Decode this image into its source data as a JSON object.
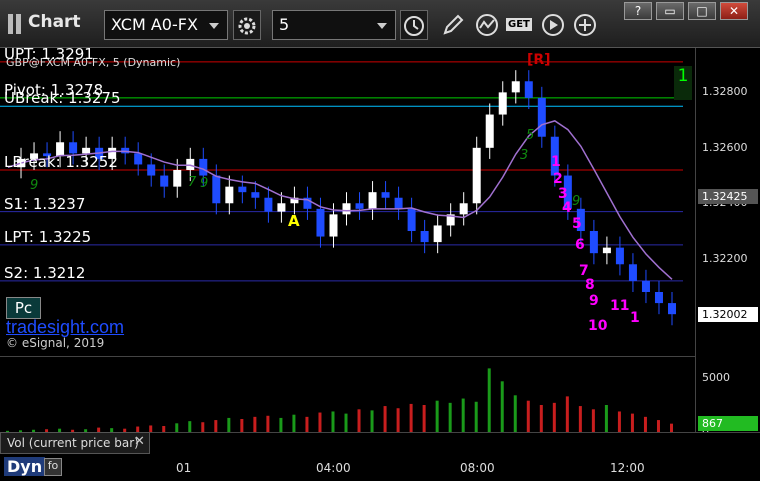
{
  "app": {
    "title": "Chart"
  },
  "toolbar": {
    "symbol": "XCM A0-FX",
    "interval": "5",
    "get_label": "GET"
  },
  "window_buttons": {
    "help": "?",
    "restore": "▭",
    "close": "✕"
  },
  "chart": {
    "header_series": "GBP@FXCM A0-FX, 5 (Dynamic)",
    "watermark": "tradesight.com",
    "copyright": "© eSignal, 2019",
    "pc_badge": "Pc",
    "vol_label": "Vol (current price bar)",
    "dyn_label": "Dyn",
    "tradesight_mark": "A",
    "r_marker": "[R]",
    "top_right_count": "1"
  },
  "colors": {
    "up": "#ffffff",
    "down": "#1f4cff",
    "pivot": "#00cc00",
    "resistance": "#cc0000",
    "support": "#2a2aa8",
    "cyan": "#00bfff",
    "ma": "#a070d0",
    "last_price": "#3a3a3a"
  },
  "chart_data": [
    {
      "type": "line",
      "title": "GBP@FXCM A0-FX, 5 (Dynamic)",
      "x_ticks": [
        "01",
        "04:00",
        "08:00",
        "12:00"
      ],
      "y_ticks": [
        1.328,
        1.326,
        1.324,
        1.322,
        1.32
      ],
      "ylim": [
        1.3186,
        1.3296
      ],
      "last_price": 1.32002,
      "ma_value": 1.32425,
      "levels": [
        {
          "name": "UPT",
          "label": "UPT: 1.3291",
          "value": 1.3291,
          "color": "#cc0000"
        },
        {
          "name": "Pivot",
          "label": "Pivot: 1.3278",
          "value": 1.3278,
          "color": "#00cc00"
        },
        {
          "name": "UBreak",
          "label": "UBreak: 1.3275",
          "value": 1.3275,
          "color": "#00bfff"
        },
        {
          "name": "LBreak",
          "label": "LBreak: 1.3252",
          "value": 1.3252,
          "color": "#cc0000"
        },
        {
          "name": "S1",
          "label": "S1: 1.3237",
          "value": 1.3237,
          "color": "#2a2aa8"
        },
        {
          "name": "LPT",
          "label": "LPT: 1.3225",
          "value": 1.3225,
          "color": "#2a2aa8"
        },
        {
          "name": "S2",
          "label": "S2: 1.3212",
          "value": 1.3212,
          "color": "#2a2aa8"
        }
      ],
      "series": [
        {
          "name": "",
          "values": [
            1.3253,
            1.3256,
            1.3258,
            1.3257,
            1.3262,
            1.3258,
            1.326,
            1.3256,
            1.326,
            1.3258,
            1.3254,
            1.325,
            1.3246,
            1.3252,
            1.3256,
            1.325,
            1.324,
            1.3246,
            1.3244,
            1.3242,
            1.3237,
            1.324,
            1.3242,
            1.3238,
            1.3228,
            1.3236,
            1.324,
            1.3238,
            1.3244,
            1.3242,
            1.3238,
            1.323,
            1.3226,
            1.3232,
            1.3236,
            1.324,
            1.326,
            1.3272,
            1.328,
            1.3284,
            1.3278,
            1.3264,
            1.325,
            1.3238,
            1.323,
            1.3222,
            1.3224,
            1.3218,
            1.3212,
            1.3208,
            1.3204,
            1.32
          ]
        }
      ]
    },
    {
      "type": "bar",
      "title": "Vol (current price bar)",
      "y_ticks": [
        5000,
        0
      ],
      "ylim": [
        0,
        6500
      ],
      "last_value": 867,
      "series": [
        {
          "name": "Vol (current price bar)",
          "values": [
            200,
            250,
            300,
            350,
            400,
            300,
            350,
            500,
            450,
            400,
            600,
            700,
            650,
            900,
            1100,
            1000,
            1200,
            1400,
            1300,
            1500,
            1600,
            1400,
            1700,
            1500,
            1900,
            2000,
            1800,
            2200,
            2100,
            2500,
            2300,
            2700,
            2600,
            3000,
            2800,
            3200,
            2900,
            6000,
            4800,
            3500,
            3000,
            2600,
            2800,
            3400,
            2500,
            2200,
            2600,
            2000,
            1800,
            1500,
            1200,
            867
          ]
        }
      ]
    }
  ]
}
